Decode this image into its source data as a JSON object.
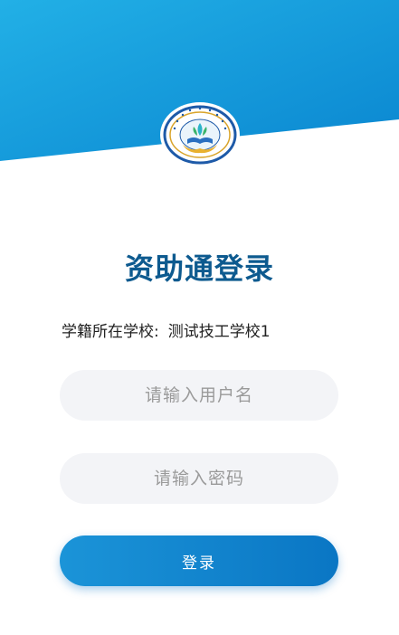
{
  "colors": {
    "header_start": "#22b0e6",
    "header_end": "#0a86d0",
    "title": "#0d5a8f",
    "field_bg": "#f3f4f7",
    "button_start": "#1b94d8",
    "button_end": "#0a76c4"
  },
  "header": {
    "logo_icon": "school-emblem-icon"
  },
  "page": {
    "title": "资助通登录"
  },
  "school": {
    "label": "学籍所在学校:",
    "name": "测试技工学校1"
  },
  "form": {
    "username_placeholder": "请输入用户名",
    "username_value": "",
    "password_placeholder": "请输入密码",
    "password_value": "",
    "login_label": "登录"
  }
}
